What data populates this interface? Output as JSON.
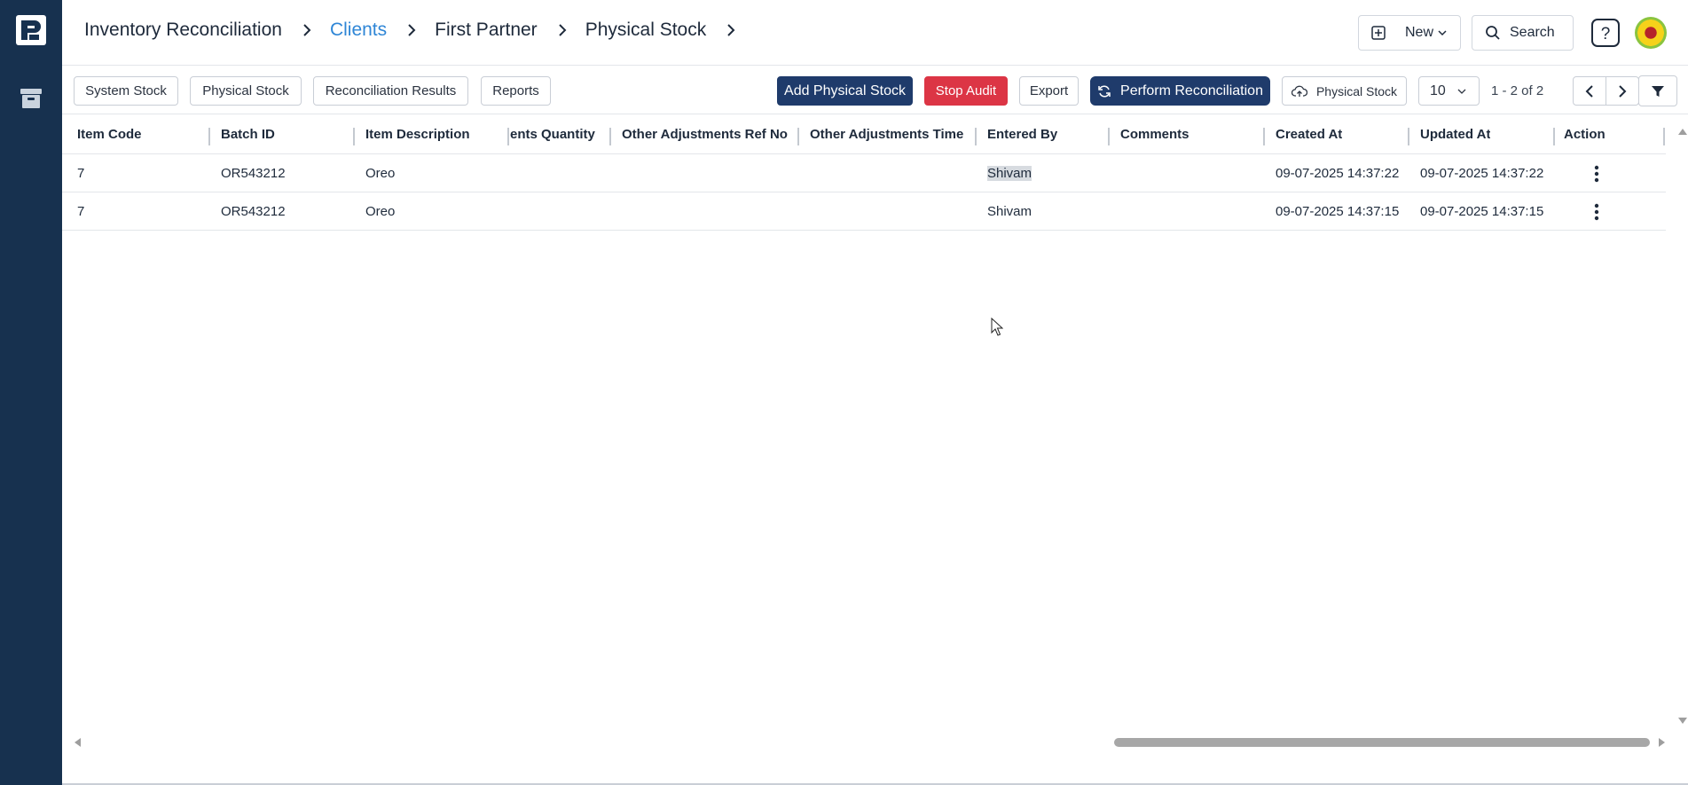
{
  "breadcrumb": [
    {
      "label": "Inventory Reconciliation",
      "active": false
    },
    {
      "label": "Clients",
      "active": true
    },
    {
      "label": "First Partner",
      "active": false
    },
    {
      "label": "Physical Stock",
      "active": false
    }
  ],
  "header": {
    "new_label": "New",
    "search_label": "Search",
    "help_icon": "help-icon",
    "avatar_icon": "avatar"
  },
  "tabs": [
    "System Stock",
    "Physical Stock",
    "Reconciliation Results",
    "Reports"
  ],
  "toolbar": {
    "add_label": "Add Physical Stock",
    "stop_label": "Stop Audit",
    "export_label": "Export",
    "perform_label": "Perform Reconciliation",
    "upload_label": "Physical Stock",
    "page_size": "10",
    "page_info": "1 - 2 of 2"
  },
  "columns": [
    "Item Code",
    "Batch ID",
    "Item Description",
    "ents Quantity",
    "Other Adjustments Ref No",
    "Other Adjustments Time",
    "Entered By",
    "Comments",
    "Created At",
    "Updated At",
    "Action"
  ],
  "rows": [
    {
      "item_code": "7",
      "batch_id": "OR543212",
      "description": "Oreo",
      "quantity": "",
      "ref_no": "",
      "adj_time": "",
      "entered_by": "Shivam",
      "comments": "",
      "created_at": "09-07-2025 14:37:22",
      "updated_at": "09-07-2025 14:37:22"
    },
    {
      "item_code": "7",
      "batch_id": "OR543212",
      "description": "Oreo",
      "quantity": "",
      "ref_no": "",
      "adj_time": "",
      "entered_by": "Shivam",
      "comments": "",
      "created_at": "09-07-2025 14:37:15",
      "updated_at": "09-07-2025 14:37:15"
    }
  ],
  "colors": {
    "sidebar": "#17314f",
    "primary": "#1f3b6b",
    "danger": "#dc3545",
    "active_crumb": "#2f86d6"
  }
}
